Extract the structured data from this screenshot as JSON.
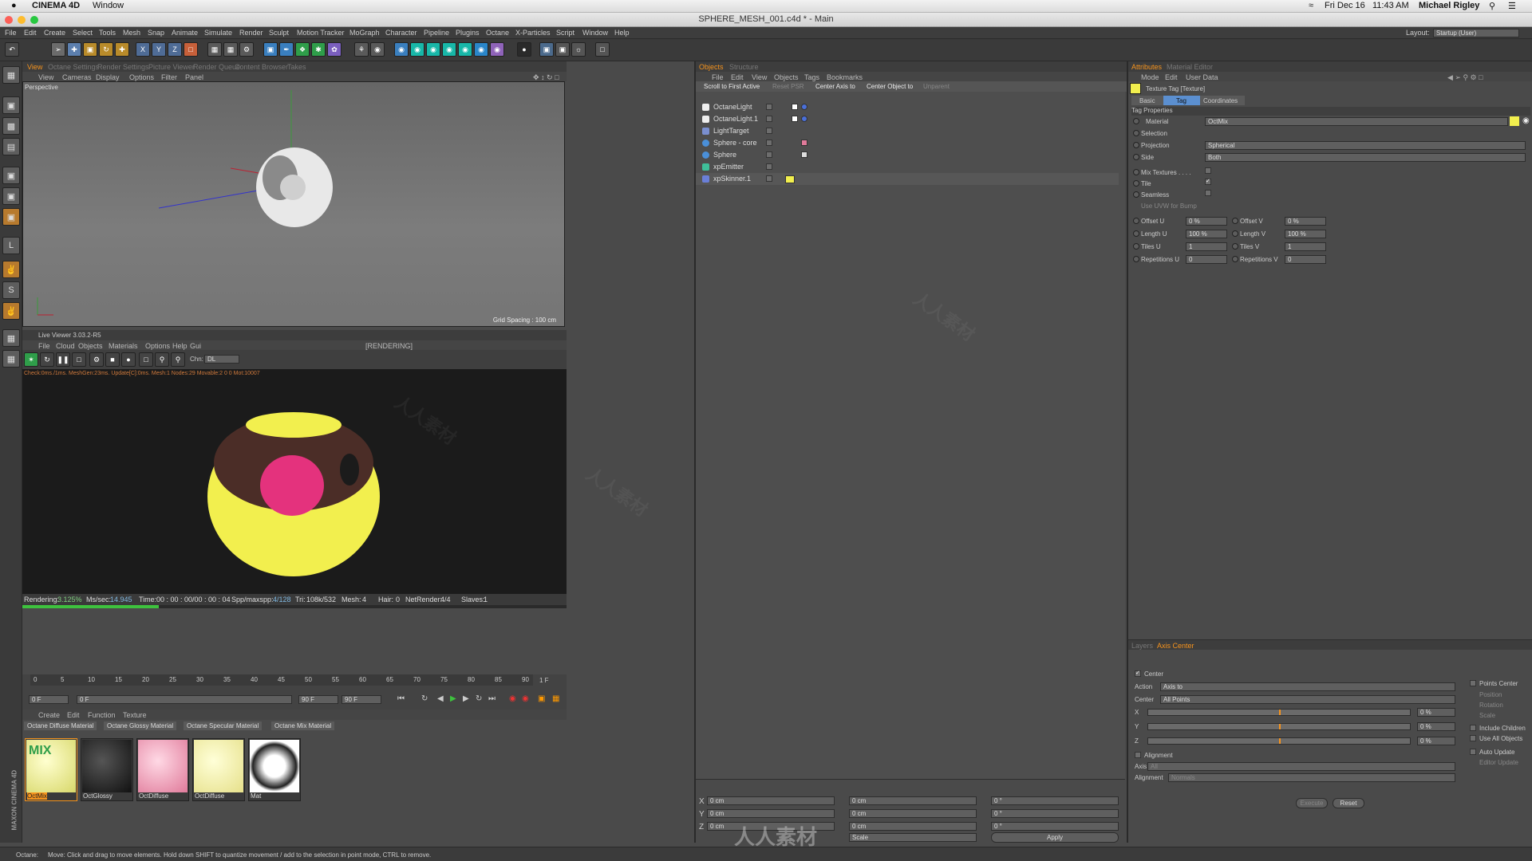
{
  "mac_menu": {
    "app": "CINEMA 4D",
    "window": "Window",
    "date": "Fri Dec 16",
    "time": "11:43 AM",
    "user": "Michael Rigley"
  },
  "title": "SPHERE_MESH_001.c4d * - Main",
  "layout": {
    "label": "Layout:",
    "value": "Startup (User)"
  },
  "menu": [
    "File",
    "Edit",
    "Create",
    "Select",
    "Tools",
    "Mesh",
    "Snap",
    "Animate",
    "Simulate",
    "Render",
    "Sculpt",
    "Motion Tracker",
    "MoGraph",
    "Character",
    "Pipeline",
    "Plugins",
    "Octane",
    "X-Particles",
    "Script",
    "Window",
    "Help"
  ],
  "viewport": {
    "tabs": [
      "View",
      "Octane Settings",
      "Render Settings",
      "Picture Viewer",
      "Render Queue",
      "Content Browser",
      "Takes"
    ],
    "menu": [
      "View",
      "Cameras",
      "Display",
      "Options",
      "Filter",
      "Panel"
    ],
    "label": "Perspective",
    "grid": "Grid Spacing : 100 cm"
  },
  "live_viewer": {
    "title": "Live Viewer 3.03.2-R5",
    "menu": [
      "File",
      "Cloud",
      "Objects",
      "Materials",
      "Options",
      "Help",
      "Gui"
    ],
    "status": "[RENDERING]",
    "chn_label": "Chn:",
    "chn_value": "DL",
    "stats_line": "Check:0ms./1ms. MeshGen:23ms. Update[C]:0ms. Mesh:1 Nodes:29 Movable:2  0 0 Mot:10007",
    "rendering_label": "Rendering:",
    "rendering_value": "3.125%",
    "ms_label": "Ms/sec:",
    "ms_value": "14.945",
    "time_label": "Time:",
    "time_value": "00 : 00 : 00/00 : 00 : 04",
    "spp_label": "Spp/maxspp:",
    "spp_value": "4/128",
    "tri_label": "Tri:",
    "tri_value": "108k/532",
    "mesh_label": "Mesh:",
    "mesh_value": "4",
    "hair_label": "Hair:",
    "hair_value": "0",
    "net_label": "NetRender:",
    "net_value": "4/4",
    "slaves_label": "Slaves:",
    "slaves_value": "1",
    "progress": 0.03125
  },
  "timeline": {
    "ticks": [
      "0",
      "5",
      "10",
      "15",
      "20",
      "25",
      "30",
      "35",
      "40",
      "45",
      "50",
      "55",
      "60",
      "65",
      "70",
      "75",
      "80",
      "85",
      "90"
    ],
    "end_label": "1 F",
    "start_field": "0 F",
    "current_field": "0 F",
    "end_field": "90 F",
    "max_field": "90 F"
  },
  "materials": {
    "menu": [
      "Create",
      "Edit",
      "Function",
      "Texture"
    ],
    "filter_tabs": [
      "Octane Diffuse Material",
      "Octane Glossy Material",
      "Octane Specular Material",
      "Octane Mix Material"
    ],
    "items": [
      {
        "label": "OctMix",
        "badge": "MIX"
      },
      {
        "label": "OctGlossy"
      },
      {
        "label": "OctDiffuse"
      },
      {
        "label": "OctDiffuse"
      },
      {
        "label": "Mat"
      }
    ]
  },
  "objects": {
    "tabs": [
      "Objects",
      "Structure"
    ],
    "menu": [
      "File",
      "Edit",
      "View",
      "Objects",
      "Tags",
      "Bookmarks"
    ],
    "buttons": [
      "Scroll to First Active",
      "Reset PSR",
      "Center Axis to",
      "Center Object to",
      "Unparent"
    ],
    "rows": [
      "OctaneLight",
      "OctaneLight.1",
      "LightTarget",
      "Sphere - core",
      "Sphere",
      "xpEmitter",
      "xpSkinner.1"
    ]
  },
  "coords": {
    "x": "0 cm",
    "y": "0 cm",
    "z": "0 cm",
    "px": "0 cm",
    "py": "0 cm",
    "pz": "0 cm",
    "h": "0 °",
    "p": "0 °",
    "b": "0 °",
    "mode": "Scale",
    "apply": "Apply"
  },
  "attributes": {
    "tabs": [
      "Attributes",
      "Material Editor"
    ],
    "menu": [
      "Mode",
      "Edit",
      "User Data"
    ],
    "header": "Texture Tag [Texture]",
    "subtabs": [
      "Basic",
      "Tag",
      "Coordinates"
    ],
    "section": "Tag Properties",
    "fields": {
      "material_label": "Material",
      "material_value": "OctMix",
      "selection_label": "Selection",
      "projection_label": "Projection",
      "projection_value": "Spherical",
      "side_label": "Side",
      "side_value": "Both",
      "mix_label": "Mix Textures . . . .",
      "tile_label": "Tile",
      "seamless_label": "Seamless",
      "uvw_label": "Use UVW for Bump",
      "offset_u_label": "Offset U",
      "offset_u": "0 %",
      "offset_v_label": "Offset V",
      "offset_v": "0 %",
      "length_u_label": "Length U",
      "length_u": "100 %",
      "length_v_label": "Length V",
      "length_v": "100 %",
      "tiles_u_label": "Tiles U",
      "tiles_u": "1",
      "tiles_v_label": "Tiles V",
      "tiles_v": "1",
      "rep_u_label": "Repetitions U",
      "rep_u": "0",
      "rep_v_label": "Repetitions V",
      "rep_v": "0"
    }
  },
  "axis_center": {
    "tabs": [
      "Layers",
      "Axis Center"
    ],
    "center_label": "Center",
    "action_label": "Action",
    "action_value": "Axis to",
    "center_field_label": "Center",
    "center_value": "All Points",
    "x_label": "X",
    "x_value": "0 %",
    "y_label": "Y",
    "y_value": "0 %",
    "z_label": "Z",
    "z_value": "0 %",
    "alignment_check": "Alignment",
    "axis_label": "Axis",
    "axis_value": "All",
    "alignment_label": "Alignment",
    "alignment_value": "Normals",
    "right_opts": [
      "Points Center",
      "Position",
      "Rotation",
      "Scale",
      "Include Children",
      "Use All Objects",
      "Auto Update",
      "Editor Update"
    ],
    "execute": "Execute",
    "reset": "Reset"
  },
  "statusbar": {
    "prefix": "Octane:",
    "text": "Move: Click and drag to move elements. Hold down SHIFT to quantize movement / add to the selection in point mode, CTRL to remove."
  },
  "brand": "MAXON CINEMA 4D",
  "watermark": "人人素材"
}
